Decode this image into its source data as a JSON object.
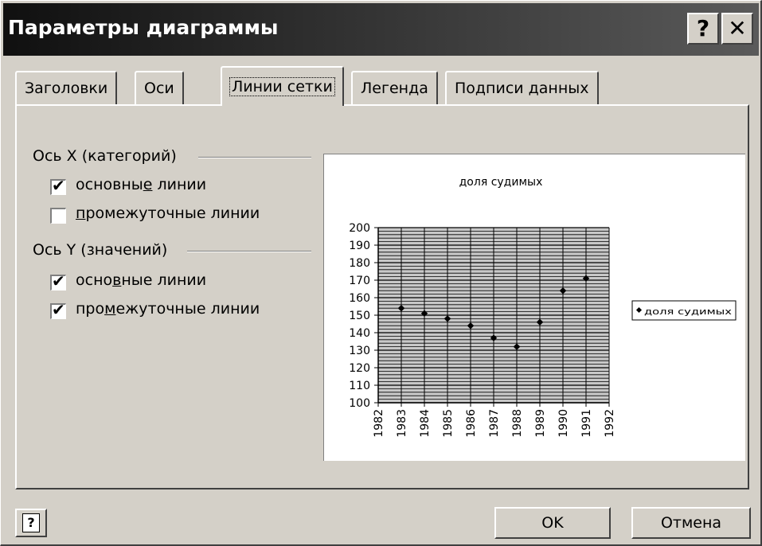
{
  "window": {
    "title": "Параметры диаграммы",
    "help_btn": "?",
    "close_btn": "✕"
  },
  "tabs": [
    {
      "label": "Заголовки",
      "active": false
    },
    {
      "label": "Оси",
      "active": false
    },
    {
      "label": "Линии сетки",
      "active": true
    },
    {
      "label": "Легенда",
      "active": false
    },
    {
      "label": "Подписи данных",
      "active": false
    }
  ],
  "groups": {
    "x_axis": {
      "label": "Ось X (категорий)",
      "major": {
        "pre": "основны",
        "ul": "е",
        "post": " линии",
        "checked": true
      },
      "minor": {
        "pre": "",
        "ul": "п",
        "post": "ромежуточные линии",
        "checked": false
      }
    },
    "y_axis": {
      "label": "Ось Y (значений)",
      "major": {
        "pre": "осно",
        "ul": "в",
        "post": "ные линии",
        "checked": true
      },
      "minor": {
        "pre": "про",
        "ul": "м",
        "post": "ежуточные линии",
        "checked": true
      }
    }
  },
  "chart_data": {
    "type": "scatter",
    "title": "доля судимых",
    "x": [
      1983,
      1984,
      1985,
      1986,
      1987,
      1988,
      1989,
      1990,
      1991
    ],
    "y": [
      154,
      151,
      148,
      144,
      137,
      132,
      146,
      164,
      171
    ],
    "xlim": [
      1982,
      1992
    ],
    "ylim": [
      100,
      200
    ],
    "x_ticks": [
      "1982",
      "1983",
      "1984",
      "1985",
      "1986",
      "1987",
      "1988",
      "1989",
      "1990",
      "1991",
      "1992"
    ],
    "y_ticks": [
      "200",
      "190",
      "180",
      "170",
      "160",
      "150",
      "140",
      "130",
      "120",
      "110",
      "100"
    ],
    "legend": {
      "label": "доля судимых",
      "position": "right"
    },
    "gridlines": {
      "x_major": true,
      "x_minor": false,
      "y_major": true,
      "y_minor": true
    }
  },
  "buttons": {
    "ok": "OK",
    "cancel": "Отмена",
    "help": "?"
  }
}
